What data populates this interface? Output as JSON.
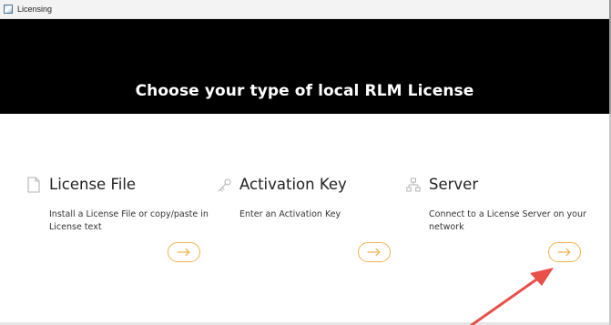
{
  "window": {
    "title": "Licensing"
  },
  "main": {
    "heading": "Choose your type of local RLM License"
  },
  "options": [
    {
      "title": "License File",
      "description": "Install a License File or copy/paste in License text",
      "icon": "document-icon"
    },
    {
      "title": "Activation Key",
      "description": "Enter an Activation Key",
      "icon": "key-icon"
    },
    {
      "title": "Server",
      "description": "Connect to a License Server on your network",
      "icon": "network-icon"
    }
  ],
  "colors": {
    "banner": "#000000",
    "accent": "#f0b44e",
    "annotation_arrow": "#e8504a"
  }
}
